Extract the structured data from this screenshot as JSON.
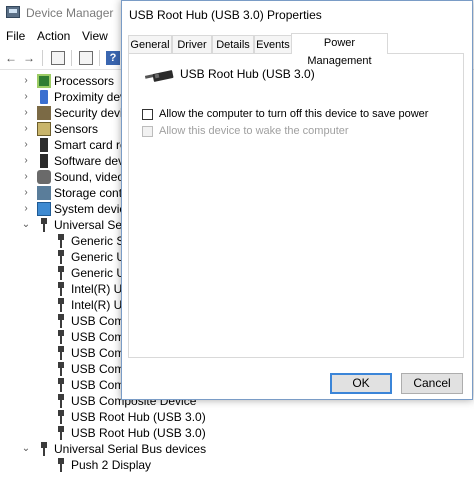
{
  "device_manager": {
    "title": "Device Manager",
    "menu": [
      "File",
      "Action",
      "View"
    ],
    "tree": [
      {
        "label": "Processors",
        "expanded": false
      },
      {
        "label": "Proximity devi",
        "expanded": false
      },
      {
        "label": "Security devic",
        "expanded": false
      },
      {
        "label": "Sensors",
        "expanded": false
      },
      {
        "label": "Smart card rea",
        "expanded": false
      },
      {
        "label": "Software devic",
        "expanded": false
      },
      {
        "label": "Sound, video a",
        "expanded": false
      },
      {
        "label": "Storage contro",
        "expanded": false
      },
      {
        "label": "System device",
        "expanded": false
      },
      {
        "label": "Universal Seria",
        "expanded": true
      },
      {
        "label": "Generic Su"
      },
      {
        "label": "Generic US"
      },
      {
        "label": "Generic US"
      },
      {
        "label": "Intel(R) US"
      },
      {
        "label": "Intel(R) US"
      },
      {
        "label": "USB Compo"
      },
      {
        "label": "USB Comp"
      },
      {
        "label": "USB Comp"
      },
      {
        "label": "USB Comp"
      },
      {
        "label": "USB Comp"
      },
      {
        "label": "USB Composite Device"
      },
      {
        "label": "USB Root Hub (USB 3.0)"
      },
      {
        "label": "USB Root Hub (USB 3.0)"
      },
      {
        "label": "Universal Serial Bus devices",
        "expanded": true
      },
      {
        "label": "Push 2 Display"
      }
    ]
  },
  "dialog": {
    "title": "USB Root Hub (USB 3.0) Properties",
    "tabs": [
      "General",
      "Driver",
      "Details",
      "Events",
      "Power Management"
    ],
    "active_tab": "Power Management",
    "device_name": "USB Root Hub (USB 3.0)",
    "options": {
      "allow_turn_off": {
        "label": "Allow the computer to turn off this device to save power",
        "checked": false,
        "enabled": true
      },
      "allow_wake": {
        "label": "Allow this device to wake the computer",
        "checked": false,
        "enabled": false
      }
    },
    "ok_label": "OK",
    "cancel_label": "Cancel"
  },
  "colors": {
    "dialog_border": "#7a9cc6",
    "default_button_border": "#3b85d8",
    "disabled_text": "#a0a0a0"
  }
}
